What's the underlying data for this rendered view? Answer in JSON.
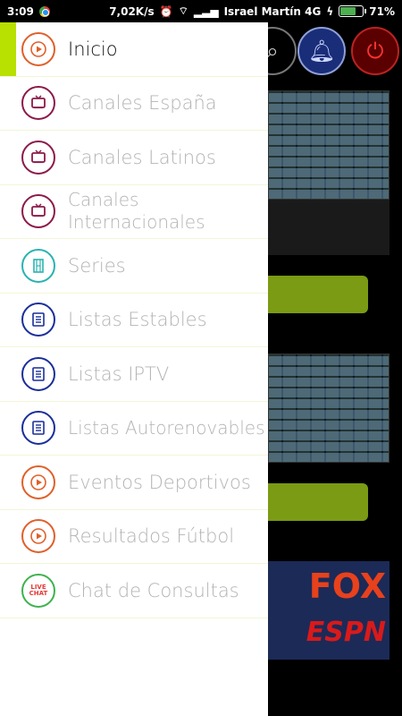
{
  "status_bar": {
    "time": "3:09",
    "speed": "7,02K/s",
    "carrier": "Israel Martín 4G",
    "battery": "71%",
    "battery_level": 0.71
  },
  "colors": {
    "accent": "#b8e000",
    "orange": "#e0602a",
    "maroon": "#8c1a4a",
    "teal": "#2ab3b0",
    "blue": "#1a2f9a",
    "green": "#3fb24f"
  },
  "menu": {
    "items": [
      {
        "label": "Inicio",
        "icon": "play-circle-icon",
        "color": "#e0602a",
        "active": true
      },
      {
        "label": "Canales España",
        "icon": "tv-icon",
        "color": "#8c1a4a"
      },
      {
        "label": "Canales Latinos",
        "icon": "tv-icon",
        "color": "#8c1a4a"
      },
      {
        "label": "Canales Internacionales",
        "icon": "tv-icon",
        "color": "#8c1a4a"
      },
      {
        "label": "Series",
        "icon": "film-icon",
        "color": "#2ab3b0"
      },
      {
        "label": "Listas Estables",
        "icon": "list-icon",
        "color": "#1a2f9a"
      },
      {
        "label": "Listas IPTV",
        "icon": "list-icon",
        "color": "#1a2f9a"
      },
      {
        "label": "Listas Autorenovables",
        "icon": "list-icon",
        "color": "#1a2f9a"
      },
      {
        "label": "Eventos Deportivos",
        "icon": "play-circle-icon",
        "color": "#e0602a"
      },
      {
        "label": "Resultados Fútbol",
        "icon": "play-circle-icon",
        "color": "#e0602a"
      },
      {
        "label": "Chat de Consultas",
        "icon": "live-chat-icon",
        "color": "#3fb24f",
        "badge_text": [
          "LIVE",
          "CHAT"
        ]
      }
    ]
  },
  "background": {
    "logos": [
      "FOX",
      "ESPN"
    ]
  }
}
